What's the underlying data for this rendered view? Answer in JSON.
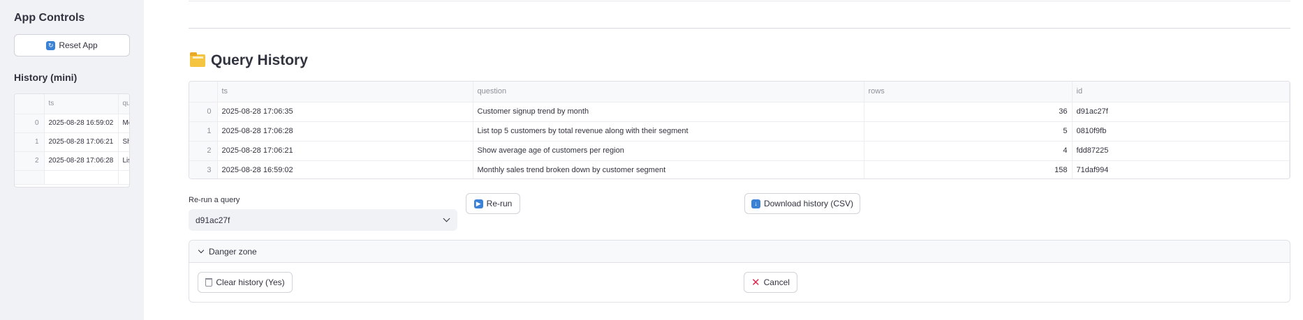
{
  "sidebar": {
    "title": "App Controls",
    "reset_label": "Reset App",
    "history_title": "History (mini)",
    "mini_table": {
      "columns": [
        "ts",
        "qu"
      ],
      "rows": [
        {
          "index": "0",
          "ts": "2025-08-28 16:59:02",
          "q": "Mo"
        },
        {
          "index": "1",
          "ts": "2025-08-28 17:06:21",
          "q": "Sh"
        },
        {
          "index": "2",
          "ts": "2025-08-28 17:06:28",
          "q": "Lis"
        }
      ]
    }
  },
  "main": {
    "heading": "Query History",
    "table": {
      "columns": [
        "ts",
        "question",
        "rows",
        "id"
      ],
      "rows": [
        {
          "index": "0",
          "ts": "2025-08-28 17:06:35",
          "question": "Customer signup trend by month",
          "rows": "36",
          "id": "d91ac27f"
        },
        {
          "index": "1",
          "ts": "2025-08-28 17:06:28",
          "question": "List top 5 customers by total revenue along with their segment",
          "rows": "5",
          "id": "0810f9fb"
        },
        {
          "index": "2",
          "ts": "2025-08-28 17:06:21",
          "question": "Show average age of customers per region",
          "rows": "4",
          "id": "fdd87225"
        },
        {
          "index": "3",
          "ts": "2025-08-28 16:59:02",
          "question": "Monthly sales trend broken down by customer segment",
          "rows": "158",
          "id": "71daf994"
        }
      ]
    },
    "rerun": {
      "label": "Re-run a query",
      "selected": "d91ac27f",
      "button_label": "Re-run"
    },
    "download_label": "Download history (CSV)",
    "danger_zone": {
      "title": "Danger zone",
      "clear_label": "Clear history (Yes)",
      "cancel_label": "Cancel"
    }
  }
}
